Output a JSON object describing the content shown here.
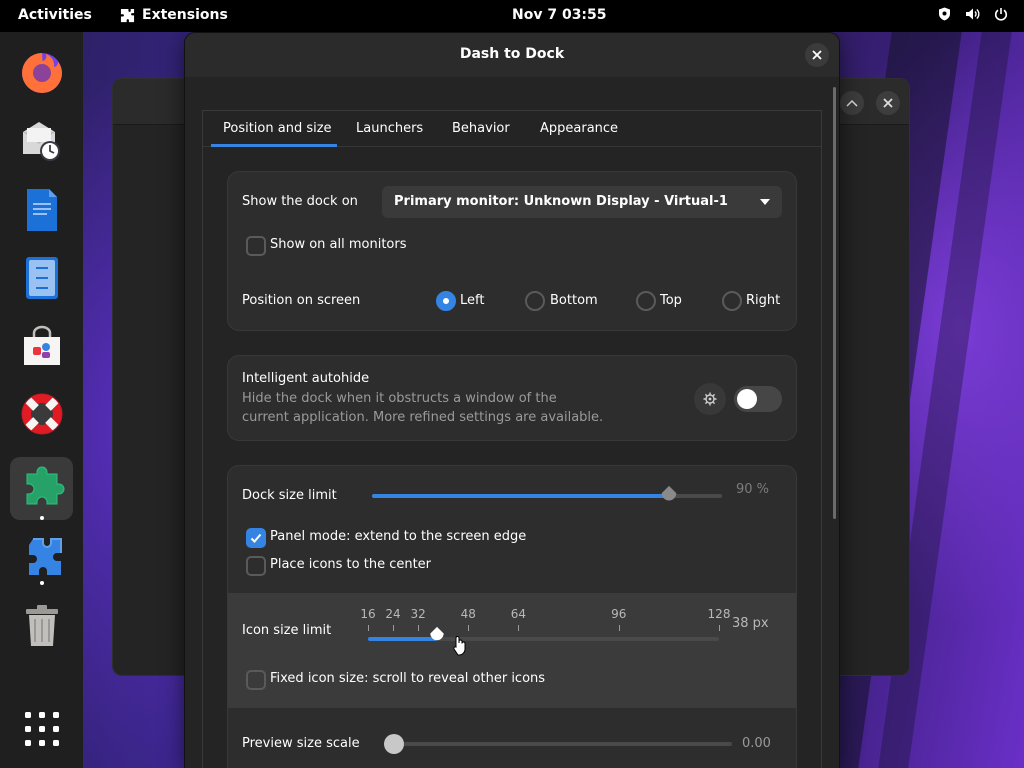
{
  "topbar": {
    "activities": "Activities",
    "app_name": "Extensions",
    "clock": "Nov 7  03:55",
    "status_icons": [
      "shield-icon",
      "volume-icon",
      "power-icon"
    ]
  },
  "dock": {
    "apps": [
      "firefox",
      "evolution-mail-calendar",
      "writer-document",
      "file-manager",
      "software-store",
      "help",
      "extension-manager",
      "extensions",
      "trash"
    ],
    "show_apps_icon": "grid-icon"
  },
  "dialog": {
    "title": "Dash to Dock",
    "tabs": [
      {
        "label": "Position and size",
        "selected": true
      },
      {
        "label": "Launchers",
        "selected": false
      },
      {
        "label": "Behavior",
        "selected": false
      },
      {
        "label": "Appearance",
        "selected": false
      }
    ],
    "monitor": {
      "label": "Show the dock on",
      "value": "Primary monitor: Unknown Display - Virtual-1",
      "all_monitors_label": "Show on all monitors",
      "all_monitors_checked": false
    },
    "position": {
      "label": "Position on screen",
      "options": [
        "Left",
        "Bottom",
        "Top",
        "Right"
      ],
      "selected": "Left"
    },
    "autohide": {
      "title": "Intelligent autohide",
      "desc_line1": "Hide the dock when it obstructs a window of the",
      "desc_line2": "current application. More refined settings are available.",
      "enabled": false
    },
    "dock_size": {
      "label": "Dock size limit",
      "value_text": "90 %",
      "value": 0.9
    },
    "panel_mode": {
      "label": "Panel mode: extend to the screen edge",
      "checked": true
    },
    "center_icons": {
      "label": "Place icons to the center",
      "checked": false
    },
    "icon_size": {
      "label": "Icon size limit",
      "ticks": [
        "16",
        "24",
        "32",
        "48",
        "64",
        "96",
        "128"
      ],
      "tick_values": [
        16,
        24,
        32,
        48,
        64,
        96,
        128
      ],
      "min": 16,
      "max": 128,
      "value": 38,
      "value_text": "38 px"
    },
    "fixed_icon": {
      "label": "Fixed icon size: scroll to reveal other icons",
      "checked": false
    },
    "preview": {
      "label": "Preview size scale",
      "value_text": "0.00",
      "value": 0
    }
  },
  "colors": {
    "accent": "#3584e4",
    "panel_bg": "#242424",
    "card_bg": "#2d2d2d"
  }
}
